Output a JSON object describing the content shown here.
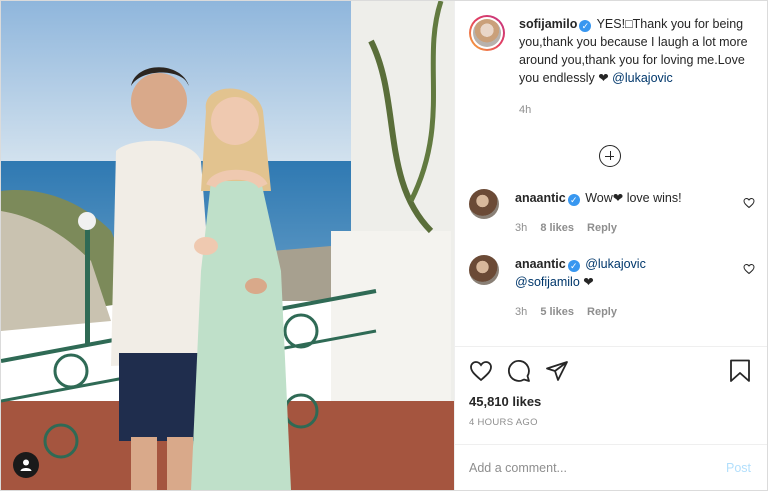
{
  "caption": {
    "username": "sofijamilo",
    "text": "YES!□Thank you for being you,thank you because I laugh a lot more around you,thank you for loving me.Love you endlessly ❤︎ ",
    "mention": "@lukajovic",
    "time": "4h"
  },
  "comments": [
    {
      "username": "anaantic",
      "text": "Wow❤︎ love wins!",
      "mention": "",
      "time": "3h",
      "likes": "8 likes",
      "reply": "Reply"
    },
    {
      "username": "anaantic",
      "text": "",
      "mention": "@lukajovic",
      "mention2": "@sofijamilo",
      "trail": " ❤︎",
      "time": "3h",
      "likes": "5 likes",
      "reply": "Reply"
    }
  ],
  "footer": {
    "likes": "45,810 likes",
    "time_ago": "4 HOURS AGO",
    "add_comment_placeholder": "Add a comment...",
    "post_label": "Post"
  },
  "icons": {
    "like": "heart-icon",
    "comment": "comment-icon",
    "share": "share-icon",
    "save": "bookmark-icon",
    "tagged": "user-tag-icon",
    "load_more": "plus-circle-icon"
  },
  "colors": {
    "link": "#00376b",
    "verified": "#3897f0",
    "meta": "#8e8e8e",
    "post_button": "#b2dffc"
  }
}
